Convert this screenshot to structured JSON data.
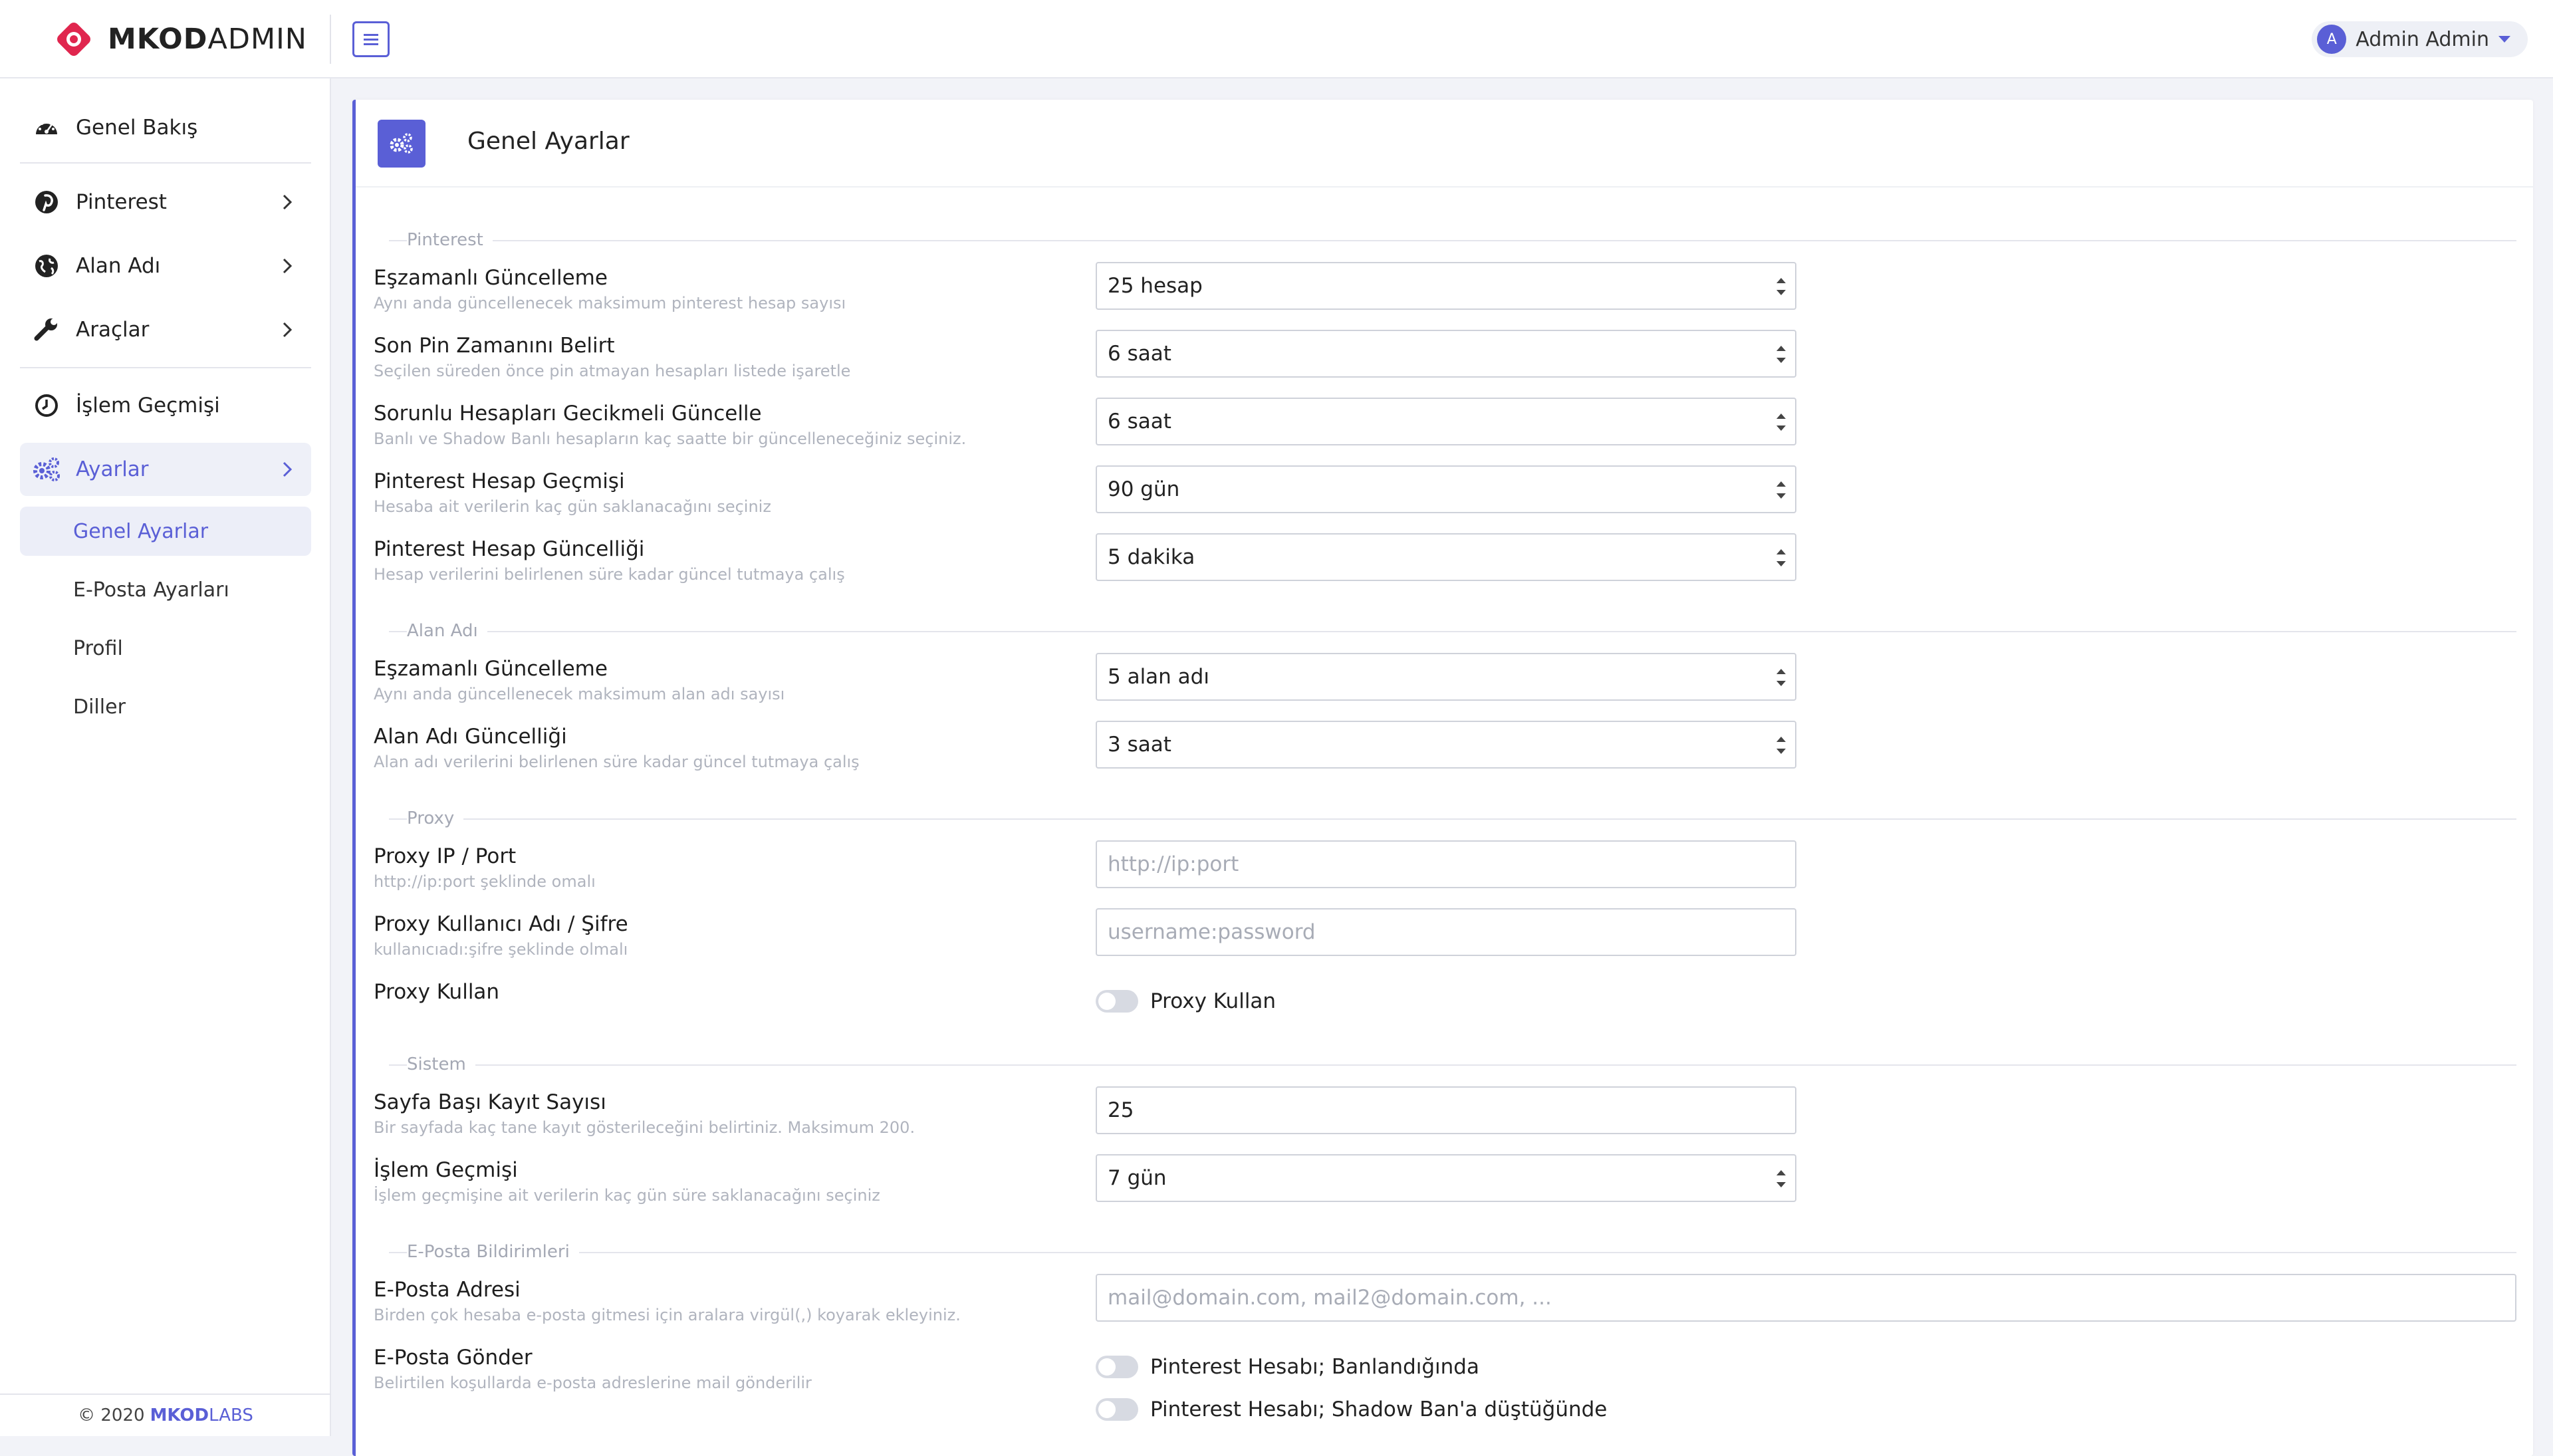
{
  "brand": {
    "name_bold": "MKOD",
    "name_light": "ADMIN"
  },
  "user": {
    "initial": "A",
    "name": "Admin Admin"
  },
  "sidebar": {
    "items": [
      {
        "label": "Genel Bakış",
        "icon": "dashboard-icon"
      },
      {
        "label": "Pinterest",
        "icon": "pinterest-icon"
      },
      {
        "label": "Alan Adı",
        "icon": "globe-icon"
      },
      {
        "label": "Araçlar",
        "icon": "wrench-icon"
      },
      {
        "label": "İşlem Geçmişi",
        "icon": "clock-icon"
      },
      {
        "label": "Ayarlar",
        "icon": "cogs-icon"
      }
    ],
    "subitems": [
      "Genel Ayarlar",
      "E-Posta Ayarları",
      "Profil",
      "Diller"
    ],
    "footer": {
      "copyright": "© 2020",
      "brand_bold": "MKOD",
      "brand_light": "LABS"
    }
  },
  "card": {
    "title": "Genel Ayarlar"
  },
  "sections": {
    "pinterest": "Pinterest",
    "domain": "Alan Adı",
    "proxy": "Proxy",
    "system": "Sistem",
    "email": "E-Posta Bildirimleri"
  },
  "settings": {
    "pin_concurrent": {
      "label": "Eşzamanlı Güncelleme",
      "desc": "Aynı anda güncellenecek maksimum pinterest hesap sayısı",
      "value": "25 hesap"
    },
    "pin_last": {
      "label": "Son Pin Zamanını Belirt",
      "desc": "Seçilen süreden önce pin atmayan hesapları listede işaretle",
      "value": "6 saat"
    },
    "pin_problem": {
      "label": "Sorunlu Hesapları Gecikmeli Güncelle",
      "desc": "Banlı ve Shadow Banlı hesapların kaç saatte bir güncelleneceğiniz seçiniz.",
      "value": "6 saat"
    },
    "pin_history": {
      "label": "Pinterest Hesap Geçmişi",
      "desc": "Hesaba ait verilerin kaç gün saklanacağını seçiniz",
      "value": "90 gün"
    },
    "pin_freshness": {
      "label": "Pinterest Hesap Güncelliği",
      "desc": "Hesap verilerini belirlenen süre kadar güncel tutmaya çalış",
      "value": "5 dakika"
    },
    "dom_concurrent": {
      "label": "Eşzamanlı Güncelleme",
      "desc": "Aynı anda güncellenecek maksimum alan adı sayısı",
      "value": "5 alan adı"
    },
    "dom_freshness": {
      "label": "Alan Adı Güncelliği",
      "desc": "Alan adı verilerini belirlenen süre kadar güncel tutmaya çalış",
      "value": "3 saat"
    },
    "proxy_ip": {
      "label": "Proxy IP / Port",
      "desc": "http://ip:port şeklinde omalı",
      "placeholder": "http://ip:port"
    },
    "proxy_auth": {
      "label": "Proxy Kullanıcı Adı / Şifre",
      "desc": "kullanıcıadı:şifre şeklinde olmalı",
      "placeholder": "username:password"
    },
    "proxy_use": {
      "label": "Proxy Kullan",
      "toggle_label": "Proxy Kullan",
      "enabled": false
    },
    "page_size": {
      "label": "Sayfa Başı Kayıt Sayısı",
      "desc": "Bir sayfada kaç tane kayıt gösterileceğini belirtiniz. Maksimum 200.",
      "value": "25"
    },
    "log_history": {
      "label": "İşlem Geçmişi",
      "desc": "İşlem geçmişine ait verilerin kaç gün süre saklanacağını seçiniz",
      "value": "7 gün"
    },
    "email_addr": {
      "label": "E-Posta Adresi",
      "desc": "Birden çok hesaba e-posta gitmesi için aralara virgül(,) koyarak ekleyiniz.",
      "placeholder": "mail@domain.com, mail2@domain.com, ..."
    },
    "email_send": {
      "label": "E-Posta Gönder",
      "desc": "Belirtilen koşullarda e-posta adreslerine mail gönderilir",
      "option1": "Pinterest Hesabı; Banlandığında",
      "option2": "Pinterest Hesabı; Shadow Ban'a düştüğünde"
    }
  },
  "colors": {
    "accent": "#5a5fd6",
    "brand_red": "#e0264e"
  }
}
